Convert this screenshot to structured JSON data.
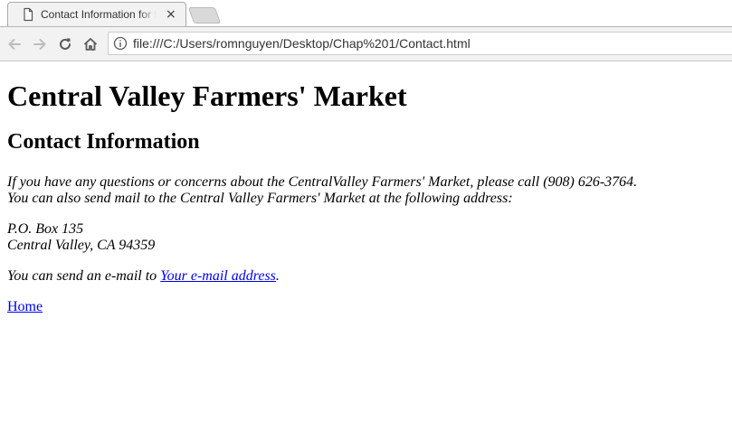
{
  "browser": {
    "tab": {
      "title": "Contact Information for t",
      "close_glyph": "×",
      "favicon": "document-icon"
    },
    "toolbar": {
      "back_icon": "back-arrow-icon",
      "forward_icon": "forward-arrow-icon",
      "reload_icon": "reload-icon",
      "home_icon": "home-icon",
      "info_icon": "info-icon",
      "url": "file:///C:/Users/romnguyen/Desktop/Chap%201/Contact.html"
    }
  },
  "page": {
    "site_title": "Central Valley Farmers' Market",
    "section_title": "Contact Information",
    "intro_line_1": "If you have any questions or concerns about the CentralValley Farmers' Market, please call (908) 626-3764.",
    "intro_line_2": "You can also send mail to the Central Valley Farmers' Market at the following address:",
    "address_line_1": "P.O. Box 135",
    "address_line_2": "Central Valley, CA 94359",
    "email_prefix": "You can send an e-mail to ",
    "email_link": "Your e-mail address",
    "email_suffix": ".",
    "home_link": "Home"
  },
  "colors": {
    "link": "#0000ee",
    "chrome_bg": "#f2f2f2"
  }
}
